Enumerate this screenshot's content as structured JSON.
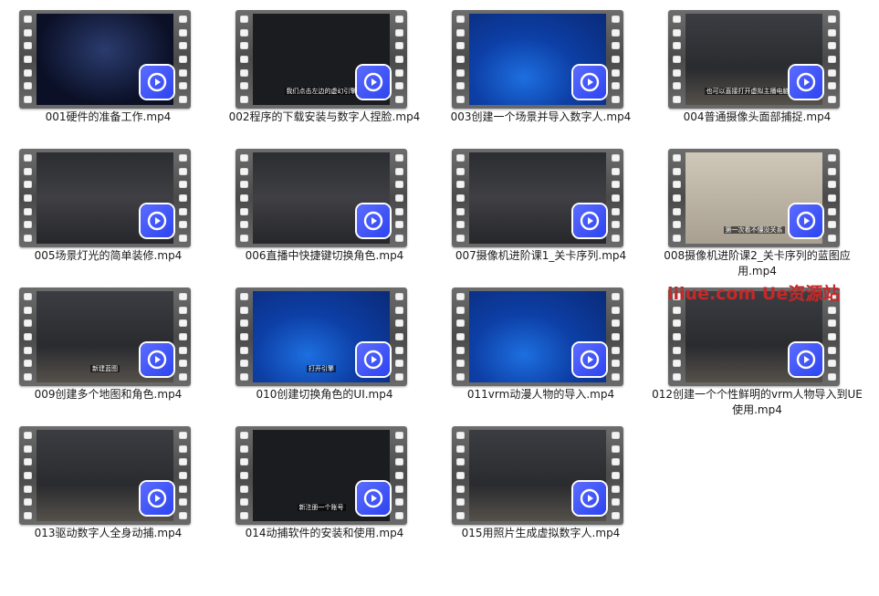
{
  "files": [
    {
      "name": "001硬件的准备工作.mp4",
      "scene": "dark",
      "subtitle": ""
    },
    {
      "name": "002程序的下载安装与数字人捏脸.mp4",
      "scene": "ue",
      "subtitle": "我们点击左边的虚幻引擎"
    },
    {
      "name": "003创建一个场景并导入数字人.mp4",
      "scene": "win",
      "subtitle": ""
    },
    {
      "name": "004普通摄像头面部捕捉.mp4",
      "scene": "room",
      "subtitle": "也可以直接打开虚拟主播电脑设置"
    },
    {
      "name": "005场景灯光的简单装修.mp4",
      "scene": "editor",
      "subtitle": ""
    },
    {
      "name": "006直播中快捷键切换角色.mp4",
      "scene": "editor",
      "subtitle": ""
    },
    {
      "name": "007摄像机进阶课1_关卡序列.mp4",
      "scene": "editor",
      "subtitle": ""
    },
    {
      "name": "008摄像机进阶课2_关卡序列的蓝图应用.mp4",
      "scene": "face",
      "subtitle": "第一次看不懂没关系"
    },
    {
      "name": "009创建多个地图和角色.mp4",
      "scene": "room",
      "subtitle": "新建蓝图"
    },
    {
      "name": "010创建切换角色的UI.mp4",
      "scene": "win",
      "subtitle": "打开引擎"
    },
    {
      "name": "011vrm动漫人物的导入.mp4",
      "scene": "win",
      "subtitle": ""
    },
    {
      "name": "012创建一个个性鲜明的vrm人物导入到UE使用.mp4",
      "scene": "room",
      "subtitle": ""
    },
    {
      "name": "013驱动数字人全身动捕.mp4",
      "scene": "room",
      "subtitle": ""
    },
    {
      "name": "014动捕软件的安装和使用.mp4",
      "scene": "ue",
      "subtitle": "新注册一个账号"
    },
    {
      "name": "015用照片生成虚拟数字人.mp4",
      "scene": "room",
      "subtitle": ""
    }
  ],
  "watermark": "iiiue.com  Ue资源站",
  "icons": {
    "play": "video-play-icon",
    "colors": {
      "play_bg": "#3a4ff5",
      "watermark": "#c62828"
    }
  }
}
